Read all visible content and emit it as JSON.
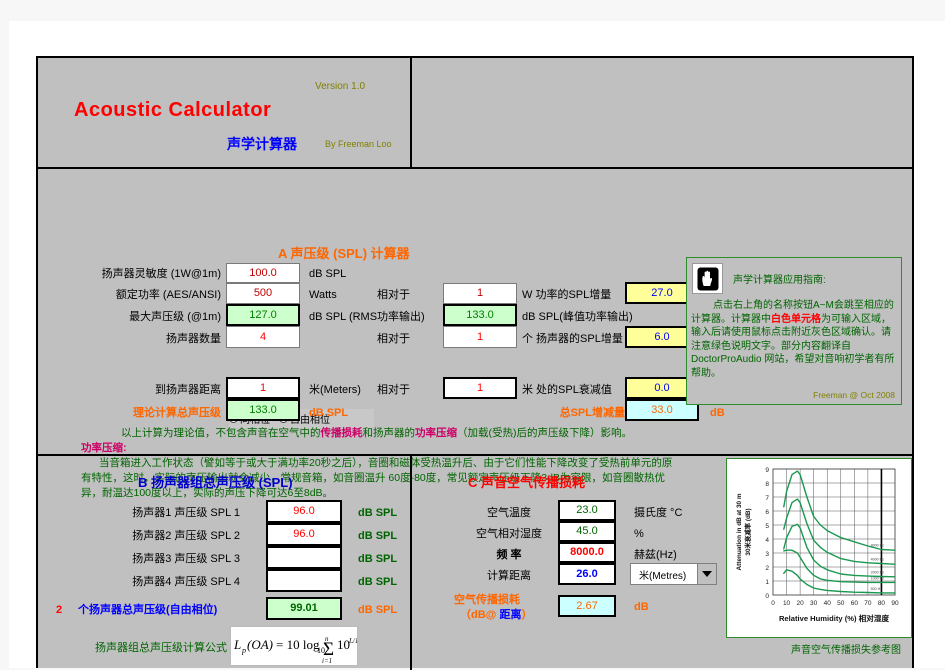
{
  "header": {
    "app_title": "Acoustic   Calculator",
    "version": "Version  1.0",
    "cn_title": "声学计算器",
    "byline": "By  Freeman Loo"
  },
  "help": {
    "title": "声学计算器应用指南:",
    "hand_icon": "hand-stop-icon",
    "line1_a": "点击右上角的名称按钮A~M会跳至相应的计算器。计算器中",
    "line1_hl": "白色单元格",
    "line1_b": "为可输入区域，输入后请使用鼠标点击附近灰色区域确认。请注意绿色说明文字。部分内容翻译自 DoctorProAudio 网站，希望对音响初学者有所帮助。",
    "signature": "Freeman @ Oct  2008"
  },
  "sectionA": {
    "title": "A    声压级 (SPL) 计算器",
    "rows": [
      {
        "label": "扬声器灵敏度 (1W@1m)",
        "value": "100.0",
        "unit": "dB SPL"
      },
      {
        "label": "额定功率 (AES/ANSI)",
        "value": "500",
        "unit": "Watts"
      },
      {
        "label": "最大声压级 (@1m)",
        "value": "127.0",
        "unit": "dB SPL (RMS功率输出)"
      },
      {
        "label": "扬声器数量",
        "value": "4",
        "unit": ""
      },
      {
        "label": "到扬声器距离",
        "value": "1",
        "unit": "米(Meters)"
      }
    ],
    "relative_label": "相对于",
    "ref_power": "1",
    "ref_count": "1",
    "ref_distance": "1",
    "power_gain_label": "W  功率的SPL增量",
    "power_gain_value": "27.0",
    "count_gain_label": "个 扬声器的SPL增量",
    "count_gain_value": "6.0",
    "distance_label": "米 处的SPL衰减值",
    "distance_value": "0.0",
    "peak_value": "133.0",
    "peak_unit": "dB  SPL(峰值功率输出)",
    "db_unit": "dB",
    "phase_same": "同相位",
    "phase_free": "自由相位",
    "phase_selected": "自由相位",
    "total_label": "理论计算总声压级",
    "total_value": "133.0",
    "total_unit": "dB SPL",
    "delta_label": "总SPL增减量",
    "delta_value": "33.0",
    "delta_unit": "dB",
    "note_line1_a": "以上计算为理论值，不包含声音在空气中的",
    "note_line1_b": "传播损耗",
    "note_line1_c": "和扬声器的",
    "note_line1_d": "功率压缩",
    "note_line1_e": "（加载(受热)后的声压级下降）影响。",
    "note_heading": "功率压缩:",
    "note_body_l1": "当音箱进入工作状态（譬如等于或大于满功率20秒之后），音圈和磁体受热温升后、由于它们性能下降改变了受热前单元的原",
    "note_body_l2": "有特性，这时，实际的声压输出就会减少，常规音箱，如音圈温升 60度-80度，常见额定声压级下降3dB为容限，如音圈散热优",
    "note_body_l3": "异，耐温达100度以上，实际的声压下降可达6至8dB。"
  },
  "sectionB": {
    "title": "B   扬声器组总声压级 (SPL)",
    "rows": [
      {
        "label": "扬声器1 声压级  SPL 1",
        "value": "96.0",
        "unit": "dB SPL"
      },
      {
        "label": "扬声器2 声压级  SPL 2",
        "value": "96.0",
        "unit": "dB SPL"
      },
      {
        "label": "扬声器3 声压级  SPL 3",
        "value": "",
        "unit": "dB SPL"
      },
      {
        "label": "扬声器4 声压级  SPL 4",
        "value": "",
        "unit": "dB SPL"
      }
    ],
    "count": "2",
    "total_label": "个扬声器总声压级(自由相位)",
    "total_value": "99.01",
    "total_unit": "dB SPL",
    "formula_label": "扬声器组总声压级计算公式",
    "formula_alt": "Lp(OA) = 10 log10 SUM 10^(Lpi/10)"
  },
  "sectionC": {
    "title": "C   声音空气传播损耗",
    "rows": [
      {
        "label": "空气温度",
        "value": "23.0",
        "unit": "摄氏度 °C",
        "color": "green"
      },
      {
        "label": "空气相对湿度",
        "value": "45.0",
        "unit": "%",
        "color": "green"
      },
      {
        "label": "频 率",
        "value": "8000.0",
        "unit": "赫兹(Hz)",
        "color": "red"
      },
      {
        "label": "计算距离",
        "value": "26.0",
        "unit": "",
        "color": "blue"
      }
    ],
    "unit_select_value": "米(Metres)",
    "unit_select_icon": "chevron-down-icon",
    "result_label_l1": "空气传播损耗",
    "result_label_l2a": "（dB@ ",
    "result_label_l2b": "距离",
    "result_label_l2c": "）",
    "result_value": "2.67",
    "result_unit": "dB",
    "chart_caption": "声音空气传播损失参考图"
  },
  "chart_data": {
    "type": "line",
    "title": "",
    "xlabel": "Relative Humidity (%)  相对湿度",
    "ylabel": "Attenuation in dB at 30 m / 30米衰减率 (dB)",
    "ylabel_en": "Attenuation in dB at 30 m",
    "ylabel_cn": "30米衰减率 (dB)",
    "xlim": [
      0,
      90
    ],
    "ylim": [
      0,
      9
    ],
    "xticks": [
      0,
      10,
      20,
      30,
      40,
      50,
      60,
      70,
      80,
      90
    ],
    "yticks": [
      0,
      1,
      2,
      3,
      4,
      5,
      6,
      7,
      8,
      9
    ],
    "grid": true,
    "line_color": "#1a9850",
    "marker_humidity": 80,
    "legend_position": "right-inline",
    "series": [
      {
        "name": "8000 Hz",
        "x": [
          8,
          10,
          14,
          18,
          20,
          25,
          30,
          35,
          40,
          50,
          60,
          70,
          80,
          90
        ],
        "y": [
          6.3,
          7.4,
          8.6,
          8.85,
          8.6,
          7.0,
          5.6,
          5.0,
          4.6,
          4.1,
          3.8,
          3.5,
          3.25,
          3.2
        ]
      },
      {
        "name": "4000 Hz",
        "x": [
          8,
          10,
          14,
          18,
          20,
          25,
          30,
          35,
          40,
          50,
          60,
          70,
          80,
          90
        ],
        "y": [
          4.7,
          5.5,
          6.6,
          6.85,
          6.6,
          5.1,
          3.9,
          3.4,
          3.05,
          2.6,
          2.4,
          2.3,
          2.25,
          2.2
        ]
      },
      {
        "name": "2000 Hz",
        "x": [
          8,
          10,
          14,
          18,
          20,
          25,
          30,
          35,
          40,
          50,
          60,
          70,
          80,
          90
        ],
        "y": [
          3.3,
          4.1,
          4.9,
          5.05,
          4.8,
          3.4,
          2.5,
          2.05,
          1.8,
          1.5,
          1.4,
          1.35,
          1.32,
          1.3
        ]
      },
      {
        "name": "1000 Hz",
        "x": [
          8,
          10,
          14,
          18,
          20,
          25,
          30,
          35,
          40,
          50,
          60,
          70,
          80,
          90
        ],
        "y": [
          3.15,
          3.2,
          3.2,
          3.0,
          2.7,
          1.9,
          1.4,
          1.15,
          1.05,
          0.95,
          0.92,
          0.9,
          0.9,
          0.9
        ]
      },
      {
        "name": "500 Hz",
        "x": [
          8,
          10,
          14,
          18,
          20,
          25,
          30,
          35,
          40,
          50,
          60,
          70,
          80,
          90
        ],
        "y": [
          1.55,
          1.8,
          1.7,
          1.4,
          1.15,
          0.75,
          0.5,
          0.4,
          0.33,
          0.25,
          0.2,
          0.18,
          0.15,
          0.15
        ]
      }
    ]
  },
  "colors": {
    "sheet_bg": "#c0c0c0",
    "input_white": "#ffffff",
    "output_green": "#ccffcc",
    "output_yellow": "#ffff99",
    "output_cyan": "#ccffff",
    "accent_red": "#ff0000",
    "accent_orange": "#ff6600",
    "accent_blue": "#0000cc",
    "accent_green": "#006400"
  }
}
